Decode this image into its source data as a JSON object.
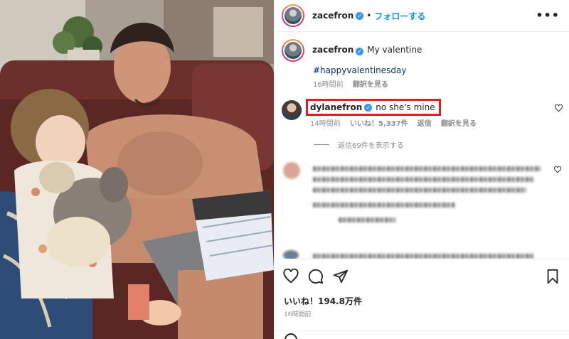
{
  "post": {
    "author": "zacefron",
    "follow_label": "フォローする",
    "dot": "•",
    "more_label": "•••",
    "verified_mark": "✓"
  },
  "caption": {
    "username": "zacefron",
    "text": "My valentine",
    "hashtag": "#happyvalentinesday",
    "time": "16時間前",
    "translate": "翻訳を見る"
  },
  "comment": {
    "username": "dylanefron",
    "text": "no she's mine",
    "time": "14時間前",
    "likes": "いいね！5,337件",
    "reply": "返信",
    "translate": "翻訳を見る",
    "view_replies": "返信69件を表示する"
  },
  "footer": {
    "likes": "いいね！194.8万件",
    "time": "16時間前"
  },
  "icons": {
    "heart": "heart-icon",
    "comment": "comment-icon",
    "share": "share-icon",
    "bookmark": "bookmark-icon",
    "more": "more-icon",
    "verified": "verified-icon"
  },
  "colors": {
    "accent": "#0095f6",
    "verified": "#3897f0",
    "highlight": "#e02020",
    "hashtag": "#00376b",
    "muted": "#8e8e8e"
  }
}
